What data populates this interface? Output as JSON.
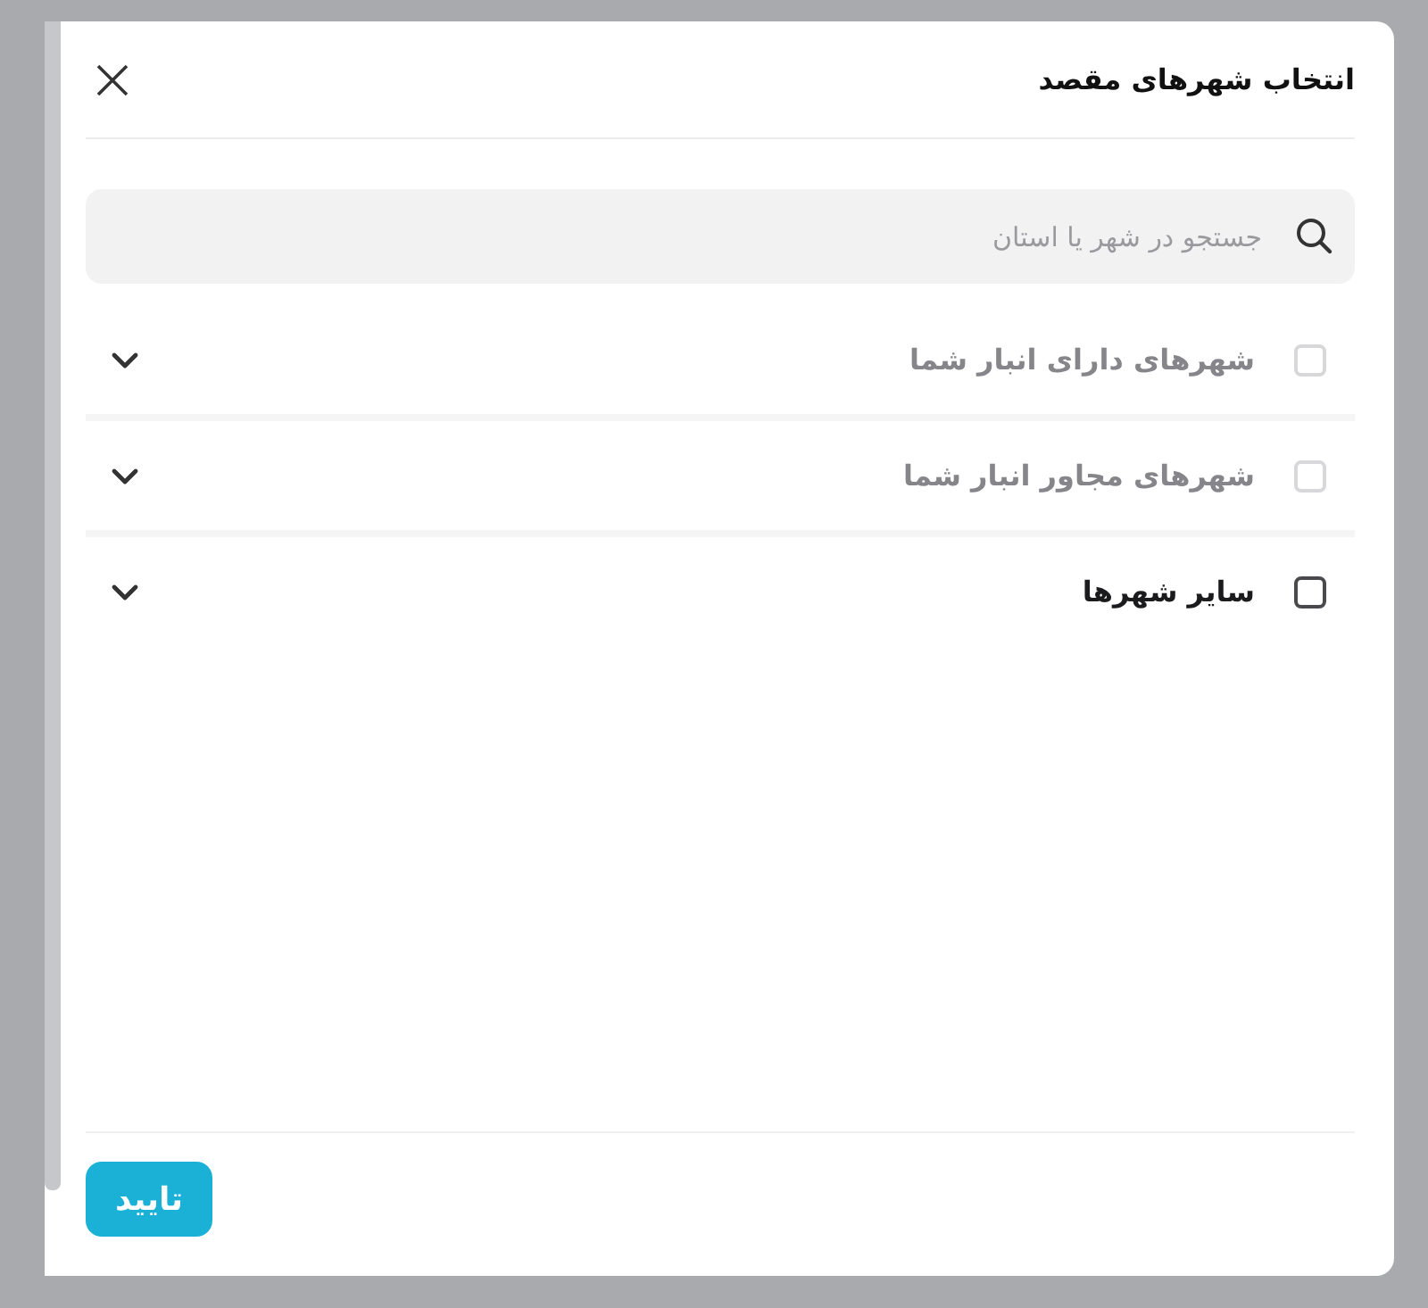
{
  "dialog": {
    "title": "انتخاب شهرهای مقصد",
    "search": {
      "placeholder": "جستجو در شهر یا استان"
    },
    "groups": [
      {
        "label": "شهرهای دارای انبار شما",
        "checked": false,
        "disabled": true,
        "expanded": false
      },
      {
        "label": "شهرهای مجاور انبار شما",
        "checked": false,
        "disabled": true,
        "expanded": false
      },
      {
        "label": "سایر شهرها",
        "checked": false,
        "disabled": false,
        "expanded": false
      }
    ],
    "confirm_button": "تایید"
  }
}
